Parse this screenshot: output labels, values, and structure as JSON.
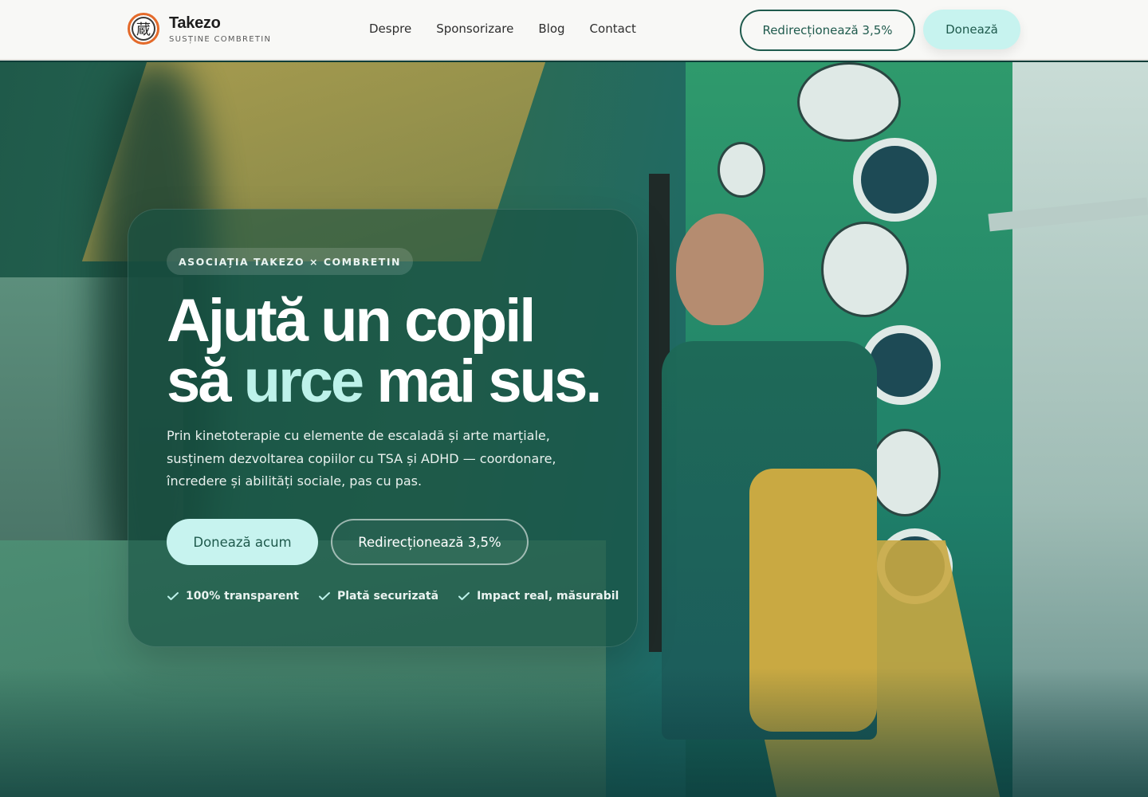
{
  "brand": {
    "logo_glyph": "蔵",
    "name": "Takezo",
    "tagline": "SUSȚINE COMBRETIN"
  },
  "nav": {
    "items": [
      "Despre",
      "Sponsorizare",
      "Blog",
      "Contact"
    ],
    "redirect_label": "Redirecționează 3,5%",
    "donate_label": "Donează"
  },
  "hero": {
    "eyebrow": "ASOCIAȚIA TAKEZO × COMBRETIN",
    "title_line1": "Ajută un copil",
    "title_line2_pre": "să ",
    "title_line2_accent": "urce",
    "title_line2_post": " mai sus.",
    "lead": "Prin kinetoterapie cu elemente de escaladă și arte marțiale, susținem dezvoltarea copiilor cu TSA și ADHD — coordonare, încredere și abilități sociale, pas cu pas.",
    "primary_cta": "Donează acum",
    "secondary_cta": "Redirecționează 3,5%",
    "badges": [
      "100% transparent",
      "Plată securizată",
      "Impact real, măsurabil"
    ]
  },
  "colors": {
    "accent_mint": "#bdf2ea",
    "brand_green": "#1f5a4d",
    "button_mint": "#c7f3ef"
  }
}
